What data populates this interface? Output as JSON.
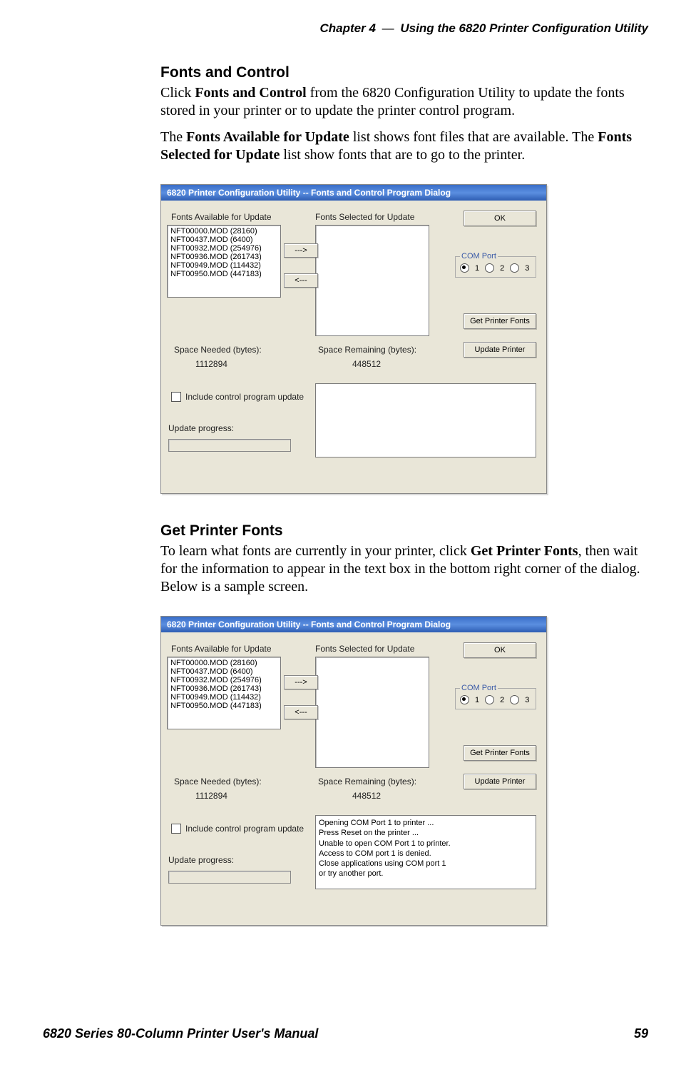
{
  "header": {
    "chapter": "Chapter  4",
    "separator": "—",
    "title": "Using the 6820 Printer Configuration Utility"
  },
  "section1": {
    "title": "Fonts and Control",
    "p1_a": "Click ",
    "p1_b": "Fonts and Control",
    "p1_c": " from the 6820 Configuration Utility to update the fonts stored in your printer or to update the printer control program.",
    "p2_a": "The ",
    "p2_b": "Fonts Available for Update",
    "p2_c": " list shows font files that are available. The ",
    "p2_d": "Fonts Selected for Update",
    "p2_e": " list show fonts that are to go to the printer."
  },
  "section2": {
    "title": "Get Printer Fonts",
    "p1_a": "To learn what fonts are currently in your printer, click ",
    "p1_b": "Get Printer Fonts",
    "p1_c": ", then wait for the information to appear in the text box in the bottom right corner of the dialog. Below is a sample screen."
  },
  "dialog": {
    "title": "6820 Printer Configuration Utility -- Fonts and Control Program Dialog",
    "labels": {
      "fonts_available": "Fonts Available for Update",
      "fonts_selected": "Fonts Selected for Update",
      "space_needed": "Space Needed (bytes):",
      "space_remaining": "Space Remaining (bytes):",
      "include_cp": "Include control program update",
      "update_progress": "Update progress:",
      "com_port": "COM Port"
    },
    "fonts_available_list": [
      "NFT00000.MOD (28160)",
      "NFT00437.MOD (6400)",
      "NFT00932.MOD (254976)",
      "NFT00936.MOD (261743)",
      "NFT00949.MOD (114432)",
      "NFT00950.MOD (447183)"
    ],
    "space_needed_value": "1112894",
    "space_remaining_value": "448512",
    "buttons": {
      "ok": "OK",
      "add": "--->",
      "remove": "<---",
      "get_fonts": "Get Printer Fonts",
      "update": "Update Printer"
    },
    "com_ports": [
      "1",
      "2",
      "3"
    ],
    "com_selected": "1",
    "status_lines_d2": [
      "Opening COM Port 1 to printer ...",
      "  Press Reset on the printer ...",
      "Unable to open COM Port 1 to printer.",
      "  Access to COM port 1 is denied.",
      "  Close applications using COM port 1",
      "    or try another port."
    ]
  },
  "footer": {
    "manual": "6820 Series 80-Column Printer User's Manual",
    "page": "59"
  }
}
